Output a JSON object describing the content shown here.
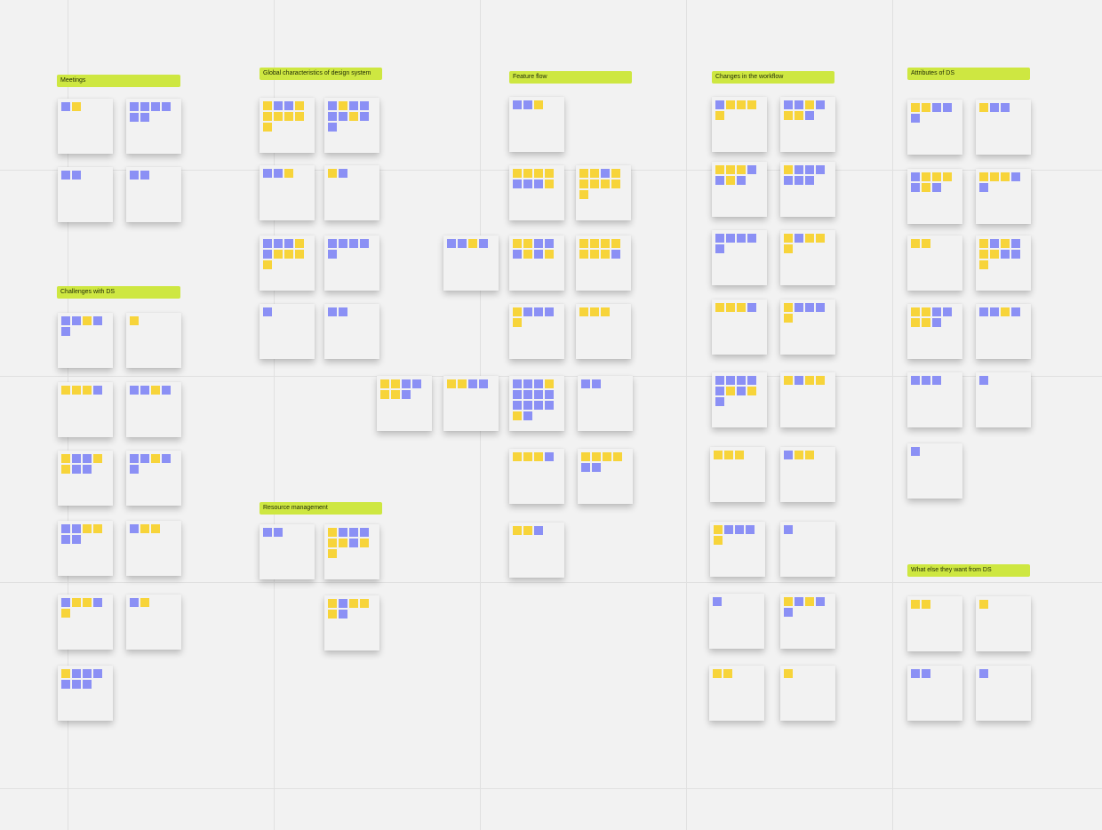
{
  "board": {
    "colors": {
      "blue": "#8b90f5",
      "yellow": "#f7d43a",
      "label": "#cee741"
    },
    "sections": [
      {
        "title": "Meetings",
        "notes": [
          {
            "dots": "by"
          },
          {
            "dots": "bbbbbb"
          },
          {
            "dots": "bb"
          },
          {
            "dots": "bb"
          }
        ]
      },
      {
        "title": "Challenges with DS",
        "notes": [
          {
            "dots": "bbybb"
          },
          {
            "dots": "y"
          },
          {
            "dots": "yyyb"
          },
          {
            "dots": "bbyb"
          },
          {
            "dots": "ybbyybb"
          },
          {
            "dots": "bbybb"
          },
          {
            "dots": "bbyybb"
          },
          {
            "dots": "byy"
          },
          {
            "dots": "byyby"
          },
          {
            "dots": "by"
          },
          {
            "dots": "ybbbbbb"
          }
        ]
      },
      {
        "title": "Global characteristics of design system",
        "notes": [
          {
            "dots": "ybbyyyyyy"
          },
          {
            "dots": "bybbbbybb"
          },
          {
            "dots": "bby"
          },
          {
            "dots": "yb"
          },
          {
            "dots": "bbbybyyyy"
          },
          {
            "dots": "bbbbb"
          },
          {
            "dots": "b"
          },
          {
            "dots": "bb"
          }
        ]
      },
      {
        "title": "",
        "notes": [
          {
            "dots": "yybbyyb"
          },
          {
            "dots": "yybb"
          },
          {
            "dots": "bbyb"
          }
        ]
      },
      {
        "title": "Resource management",
        "notes": [
          {
            "dots": "bb"
          },
          {
            "dots": "ybbbyybyy"
          },
          {
            "dots": "ybyyyb"
          }
        ]
      },
      {
        "title": "Feature flow",
        "notes": [
          {
            "dots": "bby"
          },
          {
            "dots": "yyyybbby"
          },
          {
            "dots": "yybyyyyyy"
          },
          {
            "dots": "yybbbyby"
          },
          {
            "dots": "yyyyyyyb"
          },
          {
            "dots": "ybbby"
          },
          {
            "dots": "yyy"
          },
          {
            "dots": "bbbybbbbbbbbyb"
          },
          {
            "dots": "bb"
          },
          {
            "dots": "yyyb"
          },
          {
            "dots": "yyyybb"
          },
          {
            "dots": "yyb"
          }
        ]
      },
      {
        "title": "Changes in the workflow",
        "notes": [
          {
            "dots": "byyyy"
          },
          {
            "dots": "bbybyyb"
          },
          {
            "dots": "yyybbyb"
          },
          {
            "dots": "ybbbbbb"
          },
          {
            "dots": "bbbbb"
          },
          {
            "dots": "ybyyy"
          },
          {
            "dots": "yyyb"
          },
          {
            "dots": "ybbby"
          },
          {
            "dots": "bbbbbybyb"
          },
          {
            "dots": "ybyy"
          },
          {
            "dots": "yyy"
          },
          {
            "dots": "byy"
          },
          {
            "dots": "ybbby"
          },
          {
            "dots": "b"
          },
          {
            "dots": "b"
          },
          {
            "dots": "ybybb"
          },
          {
            "dots": "yy"
          },
          {
            "dots": "y"
          }
        ]
      },
      {
        "title": "Attributes of DS",
        "notes": [
          {
            "dots": "yybbb"
          },
          {
            "dots": "ybb"
          },
          {
            "dots": "byyybyb"
          },
          {
            "dots": "yyybb"
          },
          {
            "dots": "yy"
          },
          {
            "dots": "ybybyybby"
          },
          {
            "dots": "yybbyyb"
          },
          {
            "dots": "bbyb"
          },
          {
            "dots": "bbb"
          },
          {
            "dots": "b"
          },
          {
            "dots": "b"
          }
        ]
      },
      {
        "title": "What else they want from DS",
        "notes": [
          {
            "dots": "yy"
          },
          {
            "dots": "y"
          },
          {
            "dots": "bb"
          },
          {
            "dots": "b"
          }
        ]
      }
    ]
  }
}
